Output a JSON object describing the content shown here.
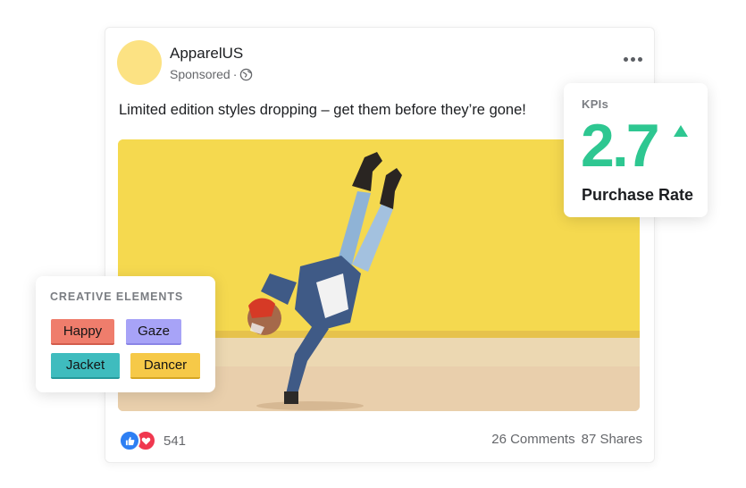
{
  "post": {
    "brand": "ApparelUS",
    "sponsored": "Sponsored",
    "separator": "·",
    "caption": "Limited edition styles dropping – get them before they’re gone!",
    "reaction_count": "541",
    "comments": "26 Comments",
    "shares": "87 Shares",
    "avatar_color": "#fce283",
    "icons": [
      "globe-icon",
      "more-icon",
      "like-icon",
      "love-icon"
    ]
  },
  "kpi": {
    "label": "KPIs",
    "value": "2.7",
    "metric": "Purchase Rate",
    "trend": "up",
    "accent": "#2ec791"
  },
  "creative": {
    "title": "CREATIVE ELEMENTS",
    "tags": [
      {
        "label": "Happy",
        "color": "#ef7d6c"
      },
      {
        "label": "Gaze",
        "color": "#a7a3f7"
      },
      {
        "label": "Jacket",
        "color": "#3fbcbe"
      },
      {
        "label": "Dancer",
        "color": "#f6c948"
      }
    ]
  }
}
